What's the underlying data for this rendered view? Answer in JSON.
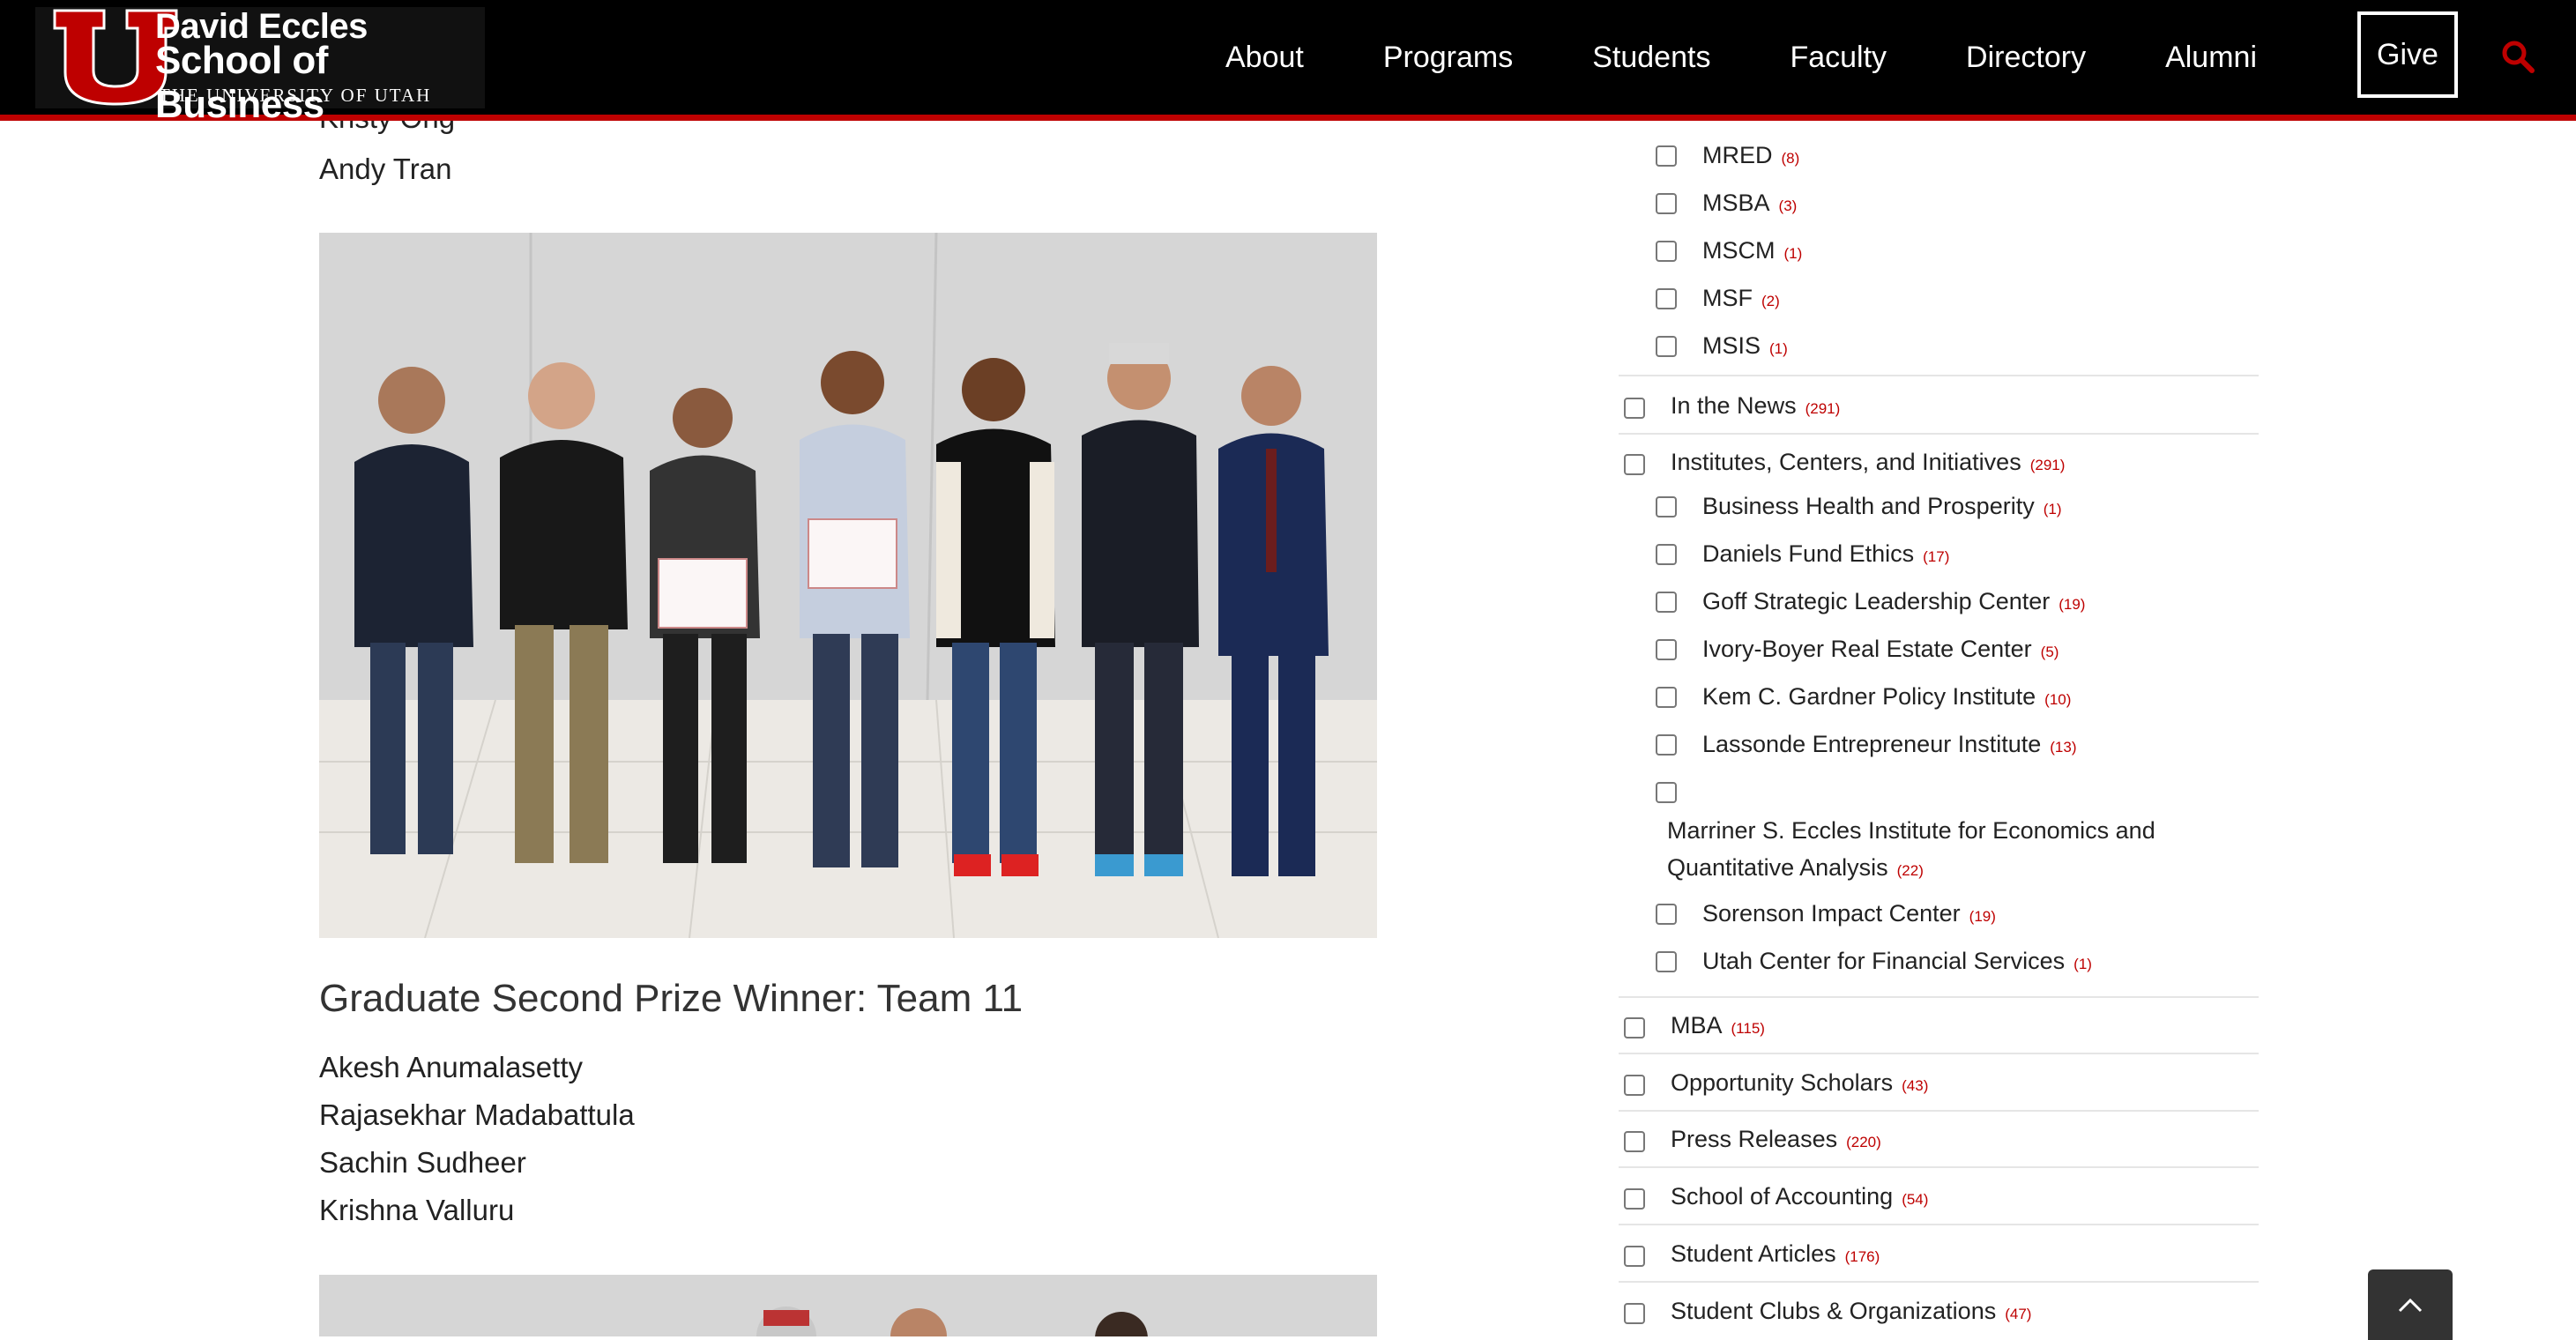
{
  "header": {
    "logo": {
      "line1": "David Eccles",
      "line2": "School of Business",
      "line3": "THE UNIVERSITY OF UTAH"
    },
    "nav": [
      "About",
      "Programs",
      "Students",
      "Faculty",
      "Directory",
      "Alumni"
    ],
    "give_label": "Give",
    "colors": {
      "bar": "#000000",
      "accent": "#be0000"
    }
  },
  "main": {
    "prev_names": [
      "Kristy Ong",
      "Andy Tran"
    ],
    "section_heading": "Graduate Second Prize Winner: Team 11",
    "team_names": [
      "Akesh Anumalasetty",
      "Rajasekhar Madabattula",
      "Sachin Sudheer",
      "Krishna Valluru"
    ]
  },
  "sidebar": {
    "top_subitems": [
      {
        "label": "MRED",
        "count": "(8)"
      },
      {
        "label": "MSBA",
        "count": "(3)"
      },
      {
        "label": "MSCM",
        "count": "(1)"
      },
      {
        "label": "MSF",
        "count": "(2)"
      },
      {
        "label": "MSIS",
        "count": "(1)"
      }
    ],
    "in_the_news": {
      "label": "In the News",
      "count": "(291)"
    },
    "institutes": {
      "label": "Institutes, Centers, and Initiatives",
      "count": "(291)",
      "children": [
        {
          "label": "Business Health and Prosperity",
          "count": "(1)"
        },
        {
          "label": "Daniels Fund Ethics",
          "count": "(17)"
        },
        {
          "label": "Goff Strategic Leadership Center",
          "count": "(19)"
        },
        {
          "label": "Ivory-Boyer Real Estate Center",
          "count": "(5)"
        },
        {
          "label": "Kem C. Gardner Policy Institute",
          "count": "(10)"
        },
        {
          "label": "Lassonde Entrepreneur Institute",
          "count": "(13)"
        },
        {
          "label": "Marriner S. Eccles Institute for Economics and Quantitative Analysis",
          "count": "(22)"
        },
        {
          "label": "Sorenson Impact Center",
          "count": "(19)"
        },
        {
          "label": "Utah Center for Financial Services",
          "count": "(1)"
        }
      ]
    },
    "bottom_items": [
      {
        "label": "MBA",
        "count": "(115)"
      },
      {
        "label": "Opportunity Scholars",
        "count": "(43)"
      },
      {
        "label": "Press Releases",
        "count": "(220)"
      },
      {
        "label": "School of Accounting",
        "count": "(54)"
      },
      {
        "label": "Student Articles",
        "count": "(176)"
      },
      {
        "label": "Student Clubs & Organizations",
        "count": "(47)"
      }
    ]
  },
  "icons": {
    "search": "search-icon",
    "scroll_top": "chevron-up-icon"
  }
}
